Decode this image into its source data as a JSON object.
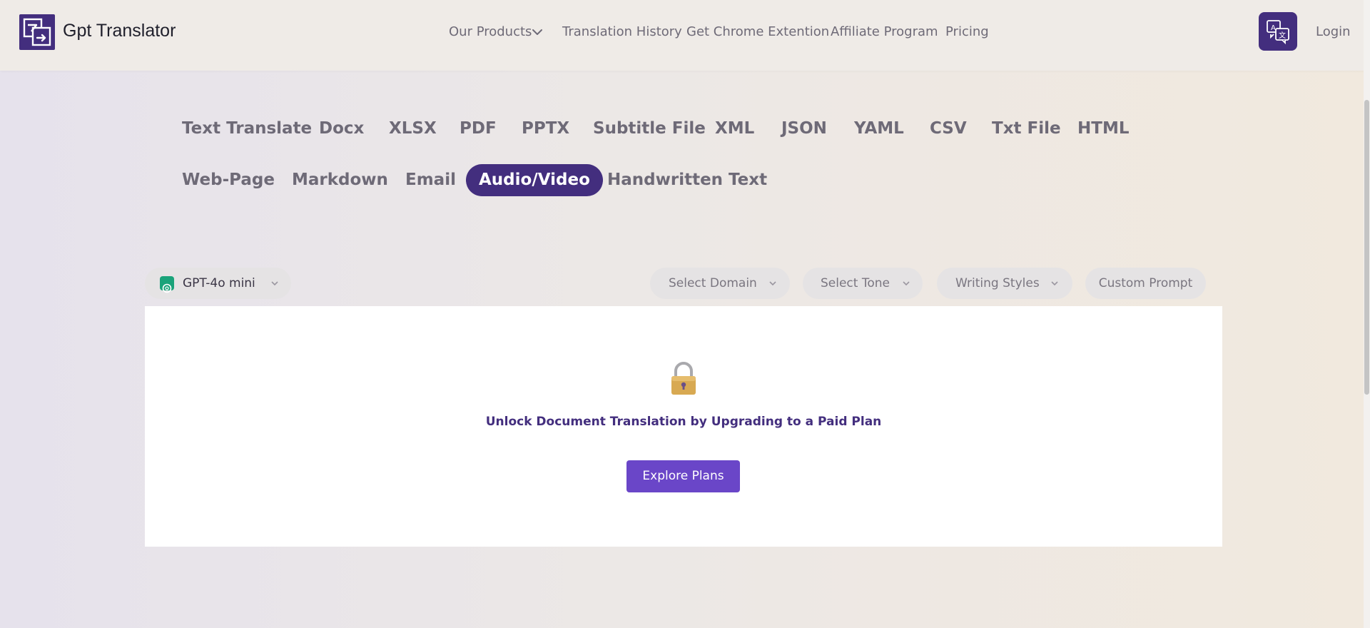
{
  "header": {
    "brand": "Gpt Translator",
    "nav": [
      "Our Products",
      "Translation History",
      "Get Chrome Extention",
      "Affiliate Program",
      "Pricing"
    ],
    "login": "Login",
    "colors": {
      "accent": "#432e7e"
    }
  },
  "tabs": {
    "row1": [
      "Text Translate",
      "Docx",
      "XLSX",
      "PDF",
      "PPTX",
      "Subtitle File",
      "XML",
      "JSON",
      "YAML",
      "CSV",
      "Txt File",
      "HTML"
    ],
    "row2": [
      "Web-Page",
      "Markdown",
      "Email",
      "Audio/Video",
      "Handwritten Text"
    ],
    "active": "Audio/Video"
  },
  "options": {
    "model": "GPT-4o mini",
    "domain": "Select Domain",
    "tone": "Select Tone",
    "styles": "Writing Styles",
    "custom_prompt": "Custom Prompt"
  },
  "panel": {
    "message": "Unlock Document Translation by Upgrading to a Paid Plan",
    "button": "Explore Plans",
    "button_color": "#6a46c8",
    "icon": "lock-icon"
  }
}
